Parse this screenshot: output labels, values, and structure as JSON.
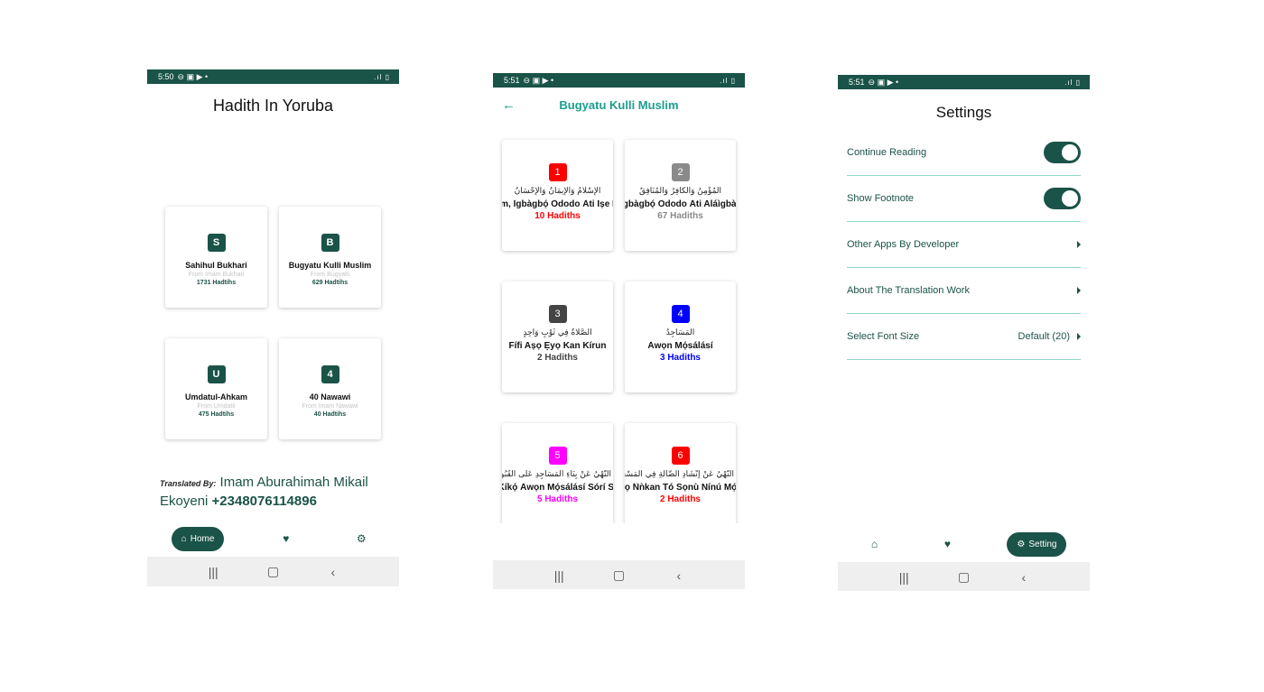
{
  "screen1": {
    "status_time": "5:50",
    "title": "Hadith In Yoruba",
    "books": [
      {
        "badge": "S",
        "name": "Sahihul Bukhari",
        "from": "From Imam Bukhari",
        "count": "1731 Hadtihs"
      },
      {
        "badge": "B",
        "name": "Bugyatu Kulli Muslim",
        "from": "From Bugyatii",
        "count": "629 Hadtihs"
      },
      {
        "badge": "U",
        "name": "Umdatul-Ahkam",
        "from": "From Umdatii",
        "count": "475 Hadtihs"
      },
      {
        "badge": "4",
        "name": "40 Nawawi",
        "from": "From Imam Nawawi",
        "count": "40 Hadtihs"
      }
    ],
    "credit_label": "Translated By:",
    "credit_name": "Imam Aburahimah Mikail Ekoyeni",
    "credit_phone": "+2348076114896",
    "nav_home_label": "Home"
  },
  "screen2": {
    "status_time": "5:51",
    "title": "Bugyatu Kulli Muslim",
    "chapters": [
      {
        "num": "1",
        "color": "#ff0000",
        "arabic": "الإِسْلَامُ وَالإِيمَانُ وَالإِحْسَانُ",
        "title": "ìsìlám, Ìgbàgbọ́ Òdodo Àti Ìṣe Rere",
        "count": "10 Hadiths"
      },
      {
        "num": "2",
        "color": "#8a8a8a",
        "arabic": "الْمُؤْمِنُ وَالْكَافِرُ وَالْمُنَافِقُ",
        "title": "Olùgbàgbọ́ Òdodo Àti Aláìgbàgbọ́",
        "count": "67 Hadiths"
      },
      {
        "num": "3",
        "color": "#444444",
        "arabic": "الصَّلَاةُ فِي ثَوْبٍ وَاحِدٍ",
        "title": "Fífi Aṣọ Ẹyọ Kan Kírun",
        "count": "2 Hadiths"
      },
      {
        "num": "4",
        "color": "#0000ff",
        "arabic": "الْمَسَاجِدُ",
        "title": "Àwọn Mọ́sálásí",
        "count": "3 Hadiths"
      },
      {
        "num": "5",
        "color": "#ff00ff",
        "arabic": "النَّهْيُ عَنْ بِنَاءِ الْمَسَاجِدِ عَلَى الْقُبُورِ",
        "title": "Ìkọ̀ Kíkọ́ Àwọn Mọ́sálásí Sórí Sàréè",
        "count": "5 Hadiths"
      },
      {
        "num": "6",
        "color": "#ff0000",
        "arabic": "النَّهْيُ عَنْ إِنْشَادِ الضَّالَّةِ فِي الْمَسْجِدِ",
        "title": "Ìkọ̀ Lílọ Ñǹkan Tó Sọnù Nínú Mọ́sálásí",
        "count": "2 Hadiths"
      }
    ]
  },
  "screen3": {
    "status_time": "5:51",
    "title": "Settings",
    "rows": [
      {
        "label": "Continue Reading",
        "type": "toggle",
        "on": true
      },
      {
        "label": "Show Footnote",
        "type": "toggle",
        "on": true
      },
      {
        "label": "Other Apps By Developer",
        "type": "link"
      },
      {
        "label": "About The Translation Work",
        "type": "link"
      },
      {
        "label": "Select Font Size",
        "type": "select",
        "value": "Default (20)"
      }
    ],
    "nav_setting_label": "Setting"
  },
  "colors": {
    "primary": "#1a5347",
    "accent": "#1a9e8e",
    "divider": "#8fd6cb"
  },
  "icons": [
    "home-icon",
    "heart-icon",
    "gear-icon",
    "back-arrow-icon",
    "chevron-right-icon"
  ]
}
